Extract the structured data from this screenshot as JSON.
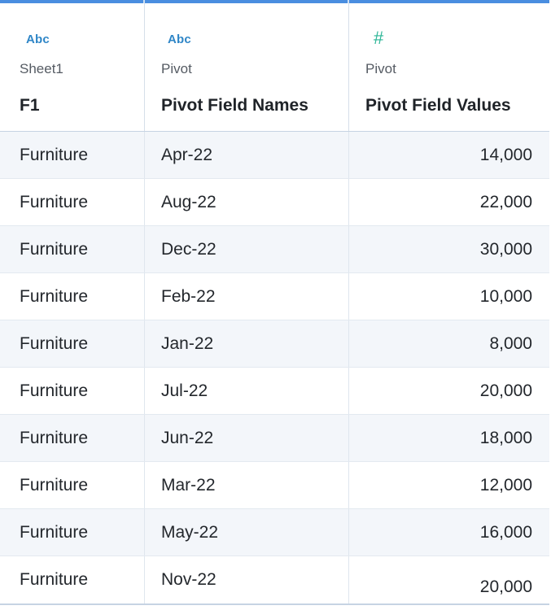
{
  "columns": [
    {
      "type_icon": "Abc",
      "type_icon_name": "text-type-icon",
      "source": "Sheet1",
      "field_name": "F1"
    },
    {
      "type_icon": "Abc",
      "type_icon_name": "text-type-icon",
      "source": "Pivot",
      "field_name": "Pivot Field Names"
    },
    {
      "type_icon": "#",
      "type_icon_name": "number-type-icon",
      "source": "Pivot",
      "field_name": "Pivot Field Values"
    }
  ],
  "rows": [
    {
      "f1": "Furniture",
      "name": "Apr-22",
      "value": "14,000"
    },
    {
      "f1": "Furniture",
      "name": "Aug-22",
      "value": "22,000"
    },
    {
      "f1": "Furniture",
      "name": "Dec-22",
      "value": "30,000"
    },
    {
      "f1": "Furniture",
      "name": "Feb-22",
      "value": "10,000"
    },
    {
      "f1": "Furniture",
      "name": "Jan-22",
      "value": "8,000"
    },
    {
      "f1": "Furniture",
      "name": "Jul-22",
      "value": "20,000"
    },
    {
      "f1": "Furniture",
      "name": "Jun-22",
      "value": "18,000"
    },
    {
      "f1": "Furniture",
      "name": "Mar-22",
      "value": "12,000"
    },
    {
      "f1": "Furniture",
      "name": "May-22",
      "value": "16,000"
    },
    {
      "f1": "Furniture",
      "name": "Nov-22",
      "value": "20,000"
    }
  ],
  "colors": {
    "text_type": "#2f86c7",
    "number_type": "#2bb596",
    "accent_bar": "#4a8ee0",
    "alt_row": "#f3f6fa"
  }
}
